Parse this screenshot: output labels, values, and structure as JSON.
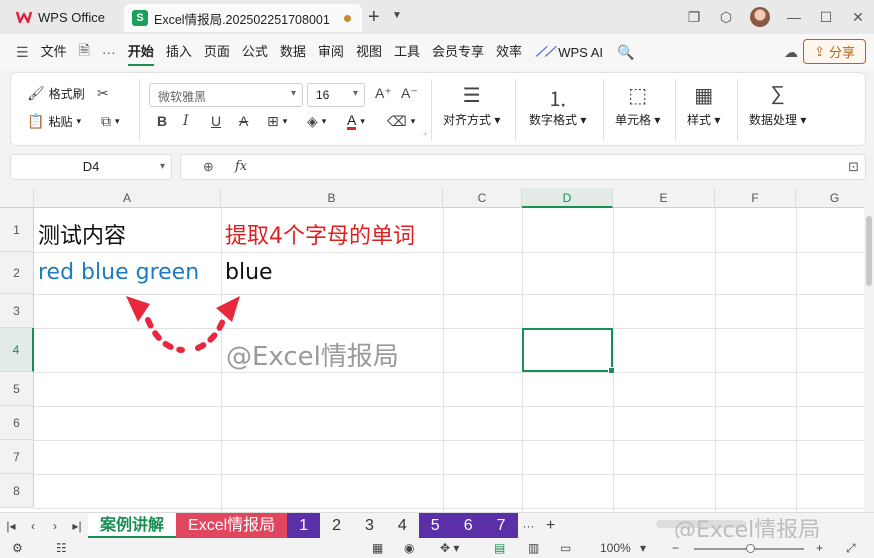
{
  "titlebar": {
    "app_label": "WPS Office",
    "doc_tab_label": "Excel情报局.202502251708001",
    "sheet_icon_letter": "S"
  },
  "menu": {
    "file": "文件",
    "items": [
      "开始",
      "插入",
      "页面",
      "公式",
      "数据",
      "审阅",
      "视图",
      "工具",
      "会员专享",
      "效率"
    ],
    "active_index": 0,
    "wps_ai": "WPS AI",
    "share": "分享"
  },
  "ribbon": {
    "format_painter": "格式刷",
    "paste": "粘贴",
    "font_name": "微软雅黑",
    "font_size": "16",
    "align": "对齐方式",
    "number_format": "数字格式",
    "cell": "单元格",
    "style": "样式",
    "data_processing": "数据处理"
  },
  "formula_bar": {
    "name_box": "D4",
    "fx_label": "fx",
    "formula": ""
  },
  "grid": {
    "columns": [
      "A",
      "B",
      "C",
      "D",
      "E",
      "F",
      "G"
    ],
    "rows": [
      "1",
      "2",
      "3",
      "4",
      "5",
      "6",
      "7",
      "8"
    ],
    "selected_cell": "D4",
    "cells": {
      "A1": "测试内容",
      "B1": "提取4个字母的单词",
      "A2": "red blue green",
      "B2": "blue"
    },
    "watermark": "@Excel情报局",
    "colors": {
      "B1": "#e02020",
      "A2": "#1f7bbf",
      "arrow": "#e8283c",
      "accent": "#1a8f53"
    }
  },
  "sheets": {
    "tabs": [
      "案例讲解",
      "Excel情报局",
      "1",
      "2",
      "3",
      "4",
      "5",
      "6",
      "7"
    ],
    "active": "案例讲解",
    "more": "···",
    "add": "+",
    "watermark": "@Excel情报局"
  },
  "statusbar": {
    "zoom": "100%"
  }
}
